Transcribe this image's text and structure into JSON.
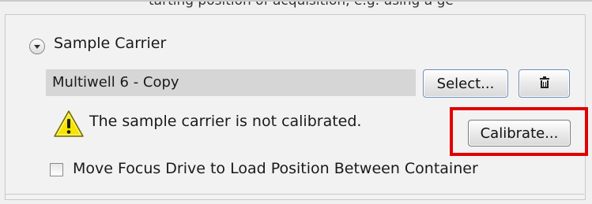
{
  "top_caption": "tarting position of acquisition, e.g. using a ge",
  "section": {
    "title": "Sample Carrier",
    "collapse_icon": "chevron-down-circle-icon"
  },
  "carrier": {
    "name": "Multiwell 6 - Copy",
    "select_label": "Select...",
    "delete_icon": "trash-icon"
  },
  "warning": {
    "icon": "warning-triangle-icon",
    "text": "The sample carrier is not calibrated.",
    "calibrate_label": "Calibrate..."
  },
  "options": {
    "move_focus_label": "Move Focus Drive to Load Position Between Container",
    "move_focus_checked": false
  },
  "colors": {
    "highlight": "#e00000",
    "warning_fill": "#f5e400",
    "button_border": "#6f8fb7"
  }
}
